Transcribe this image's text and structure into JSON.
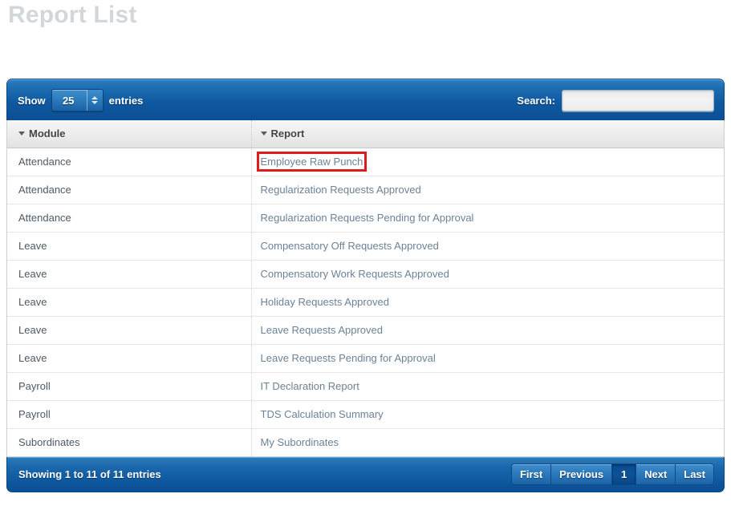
{
  "page": {
    "title": "Report List"
  },
  "toolbar": {
    "show_label": "Show",
    "entries_label": "entries",
    "length_value": "25",
    "length_options": [
      "25"
    ],
    "search_label": "Search:",
    "search_value": "",
    "search_placeholder": ""
  },
  "table": {
    "columns": [
      {
        "key": "module",
        "label": "Module",
        "sort_icon": "triangle-down-icon"
      },
      {
        "key": "report",
        "label": "Report",
        "sort_icon": "triangle-down-icon"
      }
    ],
    "rows": [
      {
        "module": "Attendance",
        "report": "Employee Raw Punch",
        "highlighted": true
      },
      {
        "module": "Attendance",
        "report": "Regularization Requests Approved",
        "highlighted": false
      },
      {
        "module": "Attendance",
        "report": "Regularization Requests Pending for Approval",
        "highlighted": false
      },
      {
        "module": "Leave",
        "report": "Compensatory Off Requests Approved",
        "highlighted": false
      },
      {
        "module": "Leave",
        "report": "Compensatory Work Requests Approved",
        "highlighted": false
      },
      {
        "module": "Leave",
        "report": "Holiday Requests Approved",
        "highlighted": false
      },
      {
        "module": "Leave",
        "report": "Leave Requests Approved",
        "highlighted": false
      },
      {
        "module": "Leave",
        "report": "Leave Requests Pending for Approval",
        "highlighted": false
      },
      {
        "module": "Payroll",
        "report": "IT Declaration Report",
        "highlighted": false
      },
      {
        "module": "Payroll",
        "report": "TDS Calculation Summary",
        "highlighted": false
      },
      {
        "module": "Subordinates",
        "report": "My Subordinates",
        "highlighted": false
      }
    ]
  },
  "footer": {
    "info": "Showing 1 to 11 of 11 entries",
    "pagination": [
      {
        "label": "First",
        "active": false
      },
      {
        "label": "Previous",
        "active": false
      },
      {
        "label": "1",
        "active": true
      },
      {
        "label": "Next",
        "active": false
      },
      {
        "label": "Last",
        "active": false
      }
    ]
  },
  "colors": {
    "bar_blue": "#0e58a0",
    "link": "#6b8297",
    "highlight_outline": "#e01b1b",
    "title_gray": "#d2d7dc"
  }
}
